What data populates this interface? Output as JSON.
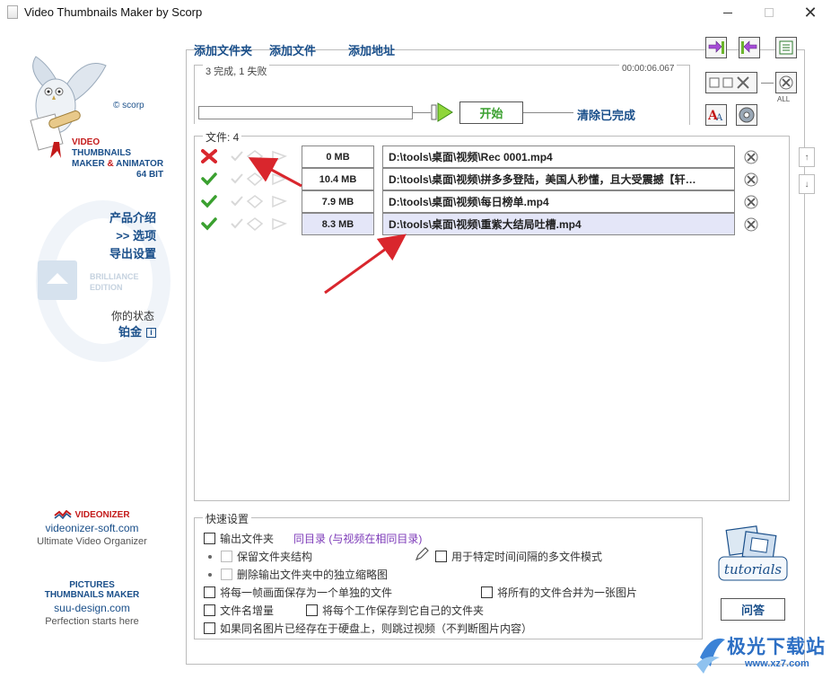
{
  "window": {
    "title": "Video Thumbnails Maker by Scorp",
    "minimize": "—",
    "maximize": "☐",
    "close": "✕"
  },
  "brand": {
    "scorp": "© scorp",
    "line1": "VIDEO",
    "line2": "THUMBNAILS",
    "line3a": "MAKER",
    "line3b": " & ",
    "line3c": "ANIMATOR",
    "line4": "64 BIT"
  },
  "left_links": {
    "product_intro": "产品介绍",
    "options": ">> 选项",
    "export_settings": "导出设置"
  },
  "edition": {
    "line1": "BRILLIANCE",
    "line2": "EDITION"
  },
  "status": {
    "label": "你的状态",
    "value": "铂金",
    "info": "i"
  },
  "promo1": {
    "title": "VIDEONIZER",
    "site": "videonizer-soft.com",
    "sub": "Ultimate Video Organizer"
  },
  "promo2": {
    "title1": "PICTURES",
    "title2": "THUMBNAILS MAKER",
    "site": "suu-design.com",
    "sub": "Perfection starts here"
  },
  "toolbar": {
    "add_folder": "添加文件夹",
    "add_file": "添加文件",
    "add_url": "添加地址"
  },
  "progress": {
    "summary": "3 完成, 1 失败",
    "elapsed": "00:00:06.067",
    "fraction": 0,
    "start": "开始",
    "clear_done": "清除已完成"
  },
  "right_tools": {
    "all_label": "ALL"
  },
  "files": {
    "label": "文件: 4",
    "rows": [
      {
        "status": "failed",
        "size": "0 MB",
        "path": "D:\\tools\\桌面\\视频\\Rec 0001.mp4",
        "selected": false
      },
      {
        "status": "done",
        "size": "10.4 MB",
        "path": "D:\\tools\\桌面\\视频\\拼多多登陆，美国人秒懂，且大受震撼【轩…",
        "selected": false
      },
      {
        "status": "done",
        "size": "7.9 MB",
        "path": "D:\\tools\\桌面\\视频\\每日榜单.mp4",
        "selected": false
      },
      {
        "status": "done",
        "size": "8.3 MB",
        "path": "D:\\tools\\桌面\\视频\\重紫大结局吐槽.mp4",
        "selected": true
      }
    ]
  },
  "scroll": {
    "up": "↑",
    "down": "↓"
  },
  "quick": {
    "label": "快速设置",
    "output_folder": "输出文件夹",
    "same_dir": "同目录 (与视频在相同目录)",
    "keep_structure": "保留文件夹结构",
    "multi_file_mode": "用于特定时间间隔的多文件模式",
    "delete_thumbs": "删除输出文件夹中的独立缩略图",
    "save_each_frame": "将每一帧画面保存为一个单独的文件",
    "merge_all": "将所有的文件合并为一张图片",
    "filename_increment": "文件名增量",
    "save_own_folder": "将每个工作保存到它自己的文件夹",
    "skip_existing": "如果同名图片已经存在于硬盘上，则跳过视频（不判断图片内容）"
  },
  "tutorials": "tutorials",
  "faq": "问答",
  "watermark": {
    "title": "极光下载站",
    "url": "www.xz7.com"
  },
  "colors": {
    "link_blue": "#1a4f8a",
    "start_green": "#3aa02f",
    "fail_red": "#d9262d",
    "selected_row": "#e4e6f8",
    "arrow_red": "#d9262d"
  }
}
